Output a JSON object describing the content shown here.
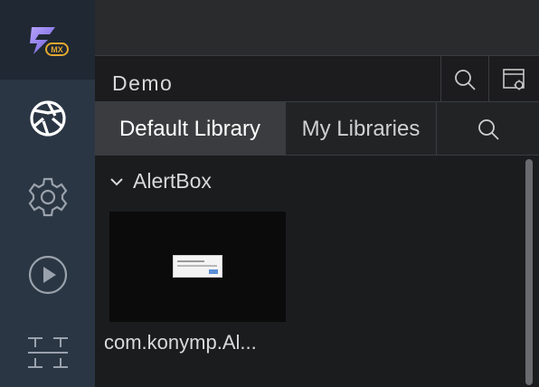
{
  "rail": {
    "logo_icon": "mx-logo-icon",
    "logo_badge": "MX",
    "items": [
      {
        "icon": "aperture-icon",
        "name": "rail-item-library"
      },
      {
        "icon": "gear-icon",
        "name": "rail-item-settings"
      },
      {
        "icon": "play-icon",
        "name": "rail-item-preview"
      },
      {
        "icon": "split-icon",
        "name": "rail-item-layout"
      }
    ]
  },
  "header": {
    "title": "Demo",
    "search_icon": "search-icon",
    "settings_icon": "window-settings-icon"
  },
  "tabs": {
    "items": [
      {
        "label": "Default Library",
        "active": true
      },
      {
        "label": "My Libraries",
        "active": false
      }
    ],
    "search_icon": "search-icon"
  },
  "library": {
    "group": {
      "label": "AlertBox",
      "expanded": true
    },
    "items": [
      {
        "label": "com.konymp.Al..."
      }
    ]
  },
  "colors": {
    "rail_bg": "#2b3644",
    "active_tab": "#3b3c3f",
    "logo_badge": "#e3a72f"
  }
}
